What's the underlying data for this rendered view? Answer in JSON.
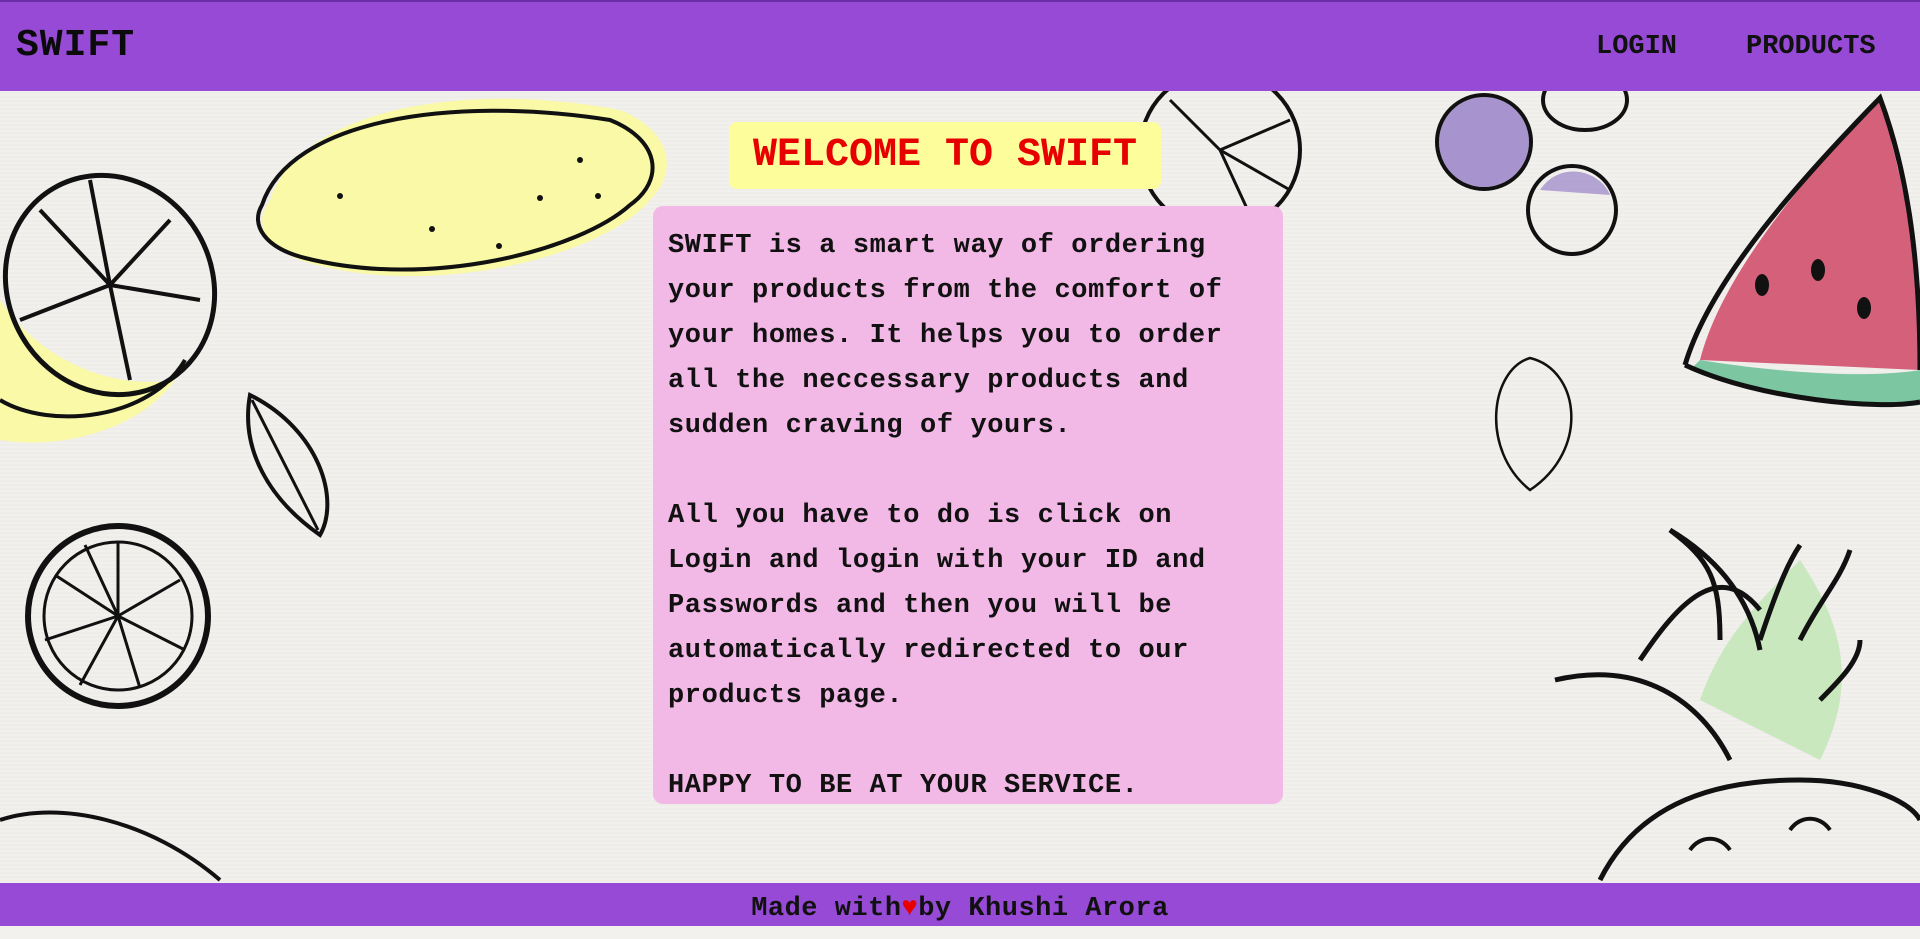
{
  "navbar": {
    "brand": "SWIFT",
    "links": [
      {
        "label": "LOGIN"
      },
      {
        "label": "PRODUCTS"
      }
    ]
  },
  "hero": {
    "title": "WELCOME TO SWIFT"
  },
  "info": {
    "paragraphs": [
      "SWIFT is a smart way of ordering your products from the comfort of your homes. It helps you to order all the neccessary products and sudden craving of yours.",
      "All you have to do is click on Login and login with your ID and Passwords and then you will be automatically redirected to our products page.",
      "HAPPY TO BE AT YOUR SERVICE."
    ]
  },
  "footer": {
    "prefix": "Made with",
    "heart": "♥",
    "suffix": "by Khushi Arora"
  },
  "colors": {
    "navbar": "#964ad6",
    "title_bg": "#fdfd9b",
    "title_text": "#e60000",
    "info_bg": "#f2b8e6"
  }
}
